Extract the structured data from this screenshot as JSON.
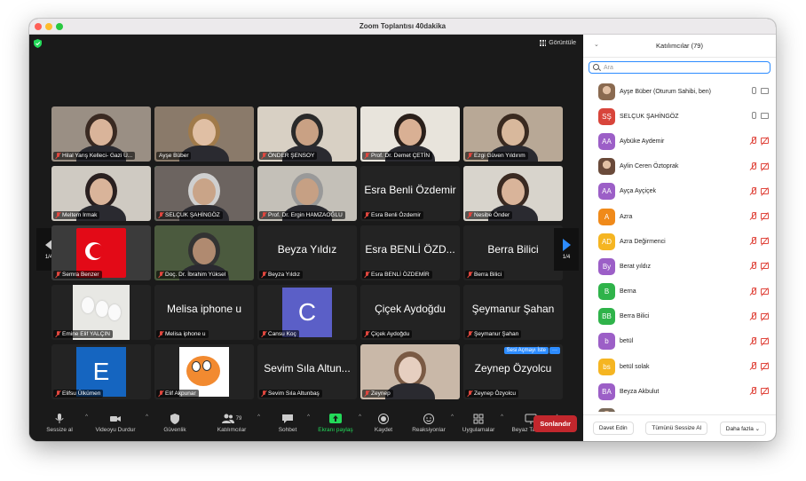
{
  "window": {
    "title": "Zoom Toplantısı  40dakika"
  },
  "view_button": {
    "label": "Görüntüle"
  },
  "pagination": {
    "left": "1/4",
    "right": "1/4"
  },
  "tiles": [
    {
      "label": "Hilal Yarış Kelleci- Gazi Ü...",
      "kind": "video",
      "bg": "#9a8f84",
      "face": "#d9b49a",
      "hair": "#3a2a22"
    },
    {
      "label": "Ayşe Büber",
      "kind": "video",
      "bg": "#8a7a6a",
      "face": "#e0bfa4",
      "hair": "#a07a4a"
    },
    {
      "label": "ÖNDER ŞENSOY",
      "kind": "video",
      "bg": "#d8d0c4",
      "face": "#c9a184",
      "hair": "#2a2a2a"
    },
    {
      "label": "Prof. Dr. Demet ÇETİN",
      "kind": "video",
      "bg": "#e8e4dc",
      "face": "#d9b094",
      "hair": "#2a1f1a"
    },
    {
      "label": "Ezgi Güven Yıldırım",
      "kind": "video",
      "bg": "#b8a896",
      "face": "#d8b89c",
      "hair": "#3a2a20"
    },
    {
      "label": "Meltem Irmak",
      "kind": "video",
      "bg": "#cfcac2",
      "face": "#d9b49a",
      "hair": "#2a2020"
    },
    {
      "label": "SELÇUK ŞAHİNGÖZ",
      "kind": "video",
      "bg": "#6c6460",
      "face": "#c9a488",
      "hair": "#cfcfcf",
      "active": true
    },
    {
      "label": "Prof. Dr. Ergin HAMZAOĞLU",
      "kind": "video",
      "bg": "#c4c0b8",
      "face": "#c6a084",
      "hair": "#999"
    },
    {
      "label": "Esra Benli Özdemir",
      "kind": "name",
      "big": "Esra Benli Özdemir"
    },
    {
      "label": "Nesibe Önder",
      "kind": "video",
      "bg": "#d8d4cc",
      "face": "#d9b49a",
      "hair": "#3a2a22"
    },
    {
      "label": "Semra Benzer",
      "kind": "flag",
      "bg": "#3b3b3b"
    },
    {
      "label": "Doç. Dr. İbrahim Yüksel",
      "kind": "video",
      "bg": "#4b5a3e",
      "face": "#b08a70",
      "hair": "#333"
    },
    {
      "label": "Beyza Yıldız",
      "kind": "name",
      "big": "Beyza Yıldız"
    },
    {
      "label": "Esra BENLİ ÖZDEMİR",
      "kind": "name",
      "big": "Esra BENLİ ÖZD..."
    },
    {
      "label": "Berra Bilici",
      "kind": "name",
      "big": "Berra Bilici"
    },
    {
      "label": "Emine Elif YALÇIN",
      "kind": "flowers",
      "bg": "#e8e8e4"
    },
    {
      "label": "Melisa iphone u",
      "kind": "name",
      "big": "Melisa iphone u"
    },
    {
      "label": "Cansu Koç",
      "kind": "letter",
      "letter": "C",
      "color": "#5b5fc7"
    },
    {
      "label": "Çiçek Aydoğdu",
      "kind": "name",
      "big": "Çiçek Aydoğdu"
    },
    {
      "label": "Şeymanur Şahan",
      "kind": "name",
      "big": "Şeymanur Şahan"
    },
    {
      "label": "Elifsu Ülkümen",
      "kind": "letter",
      "letter": "E",
      "color": "#1565c0"
    },
    {
      "label": "Elif Akpunar",
      "kind": "cartoon",
      "bg": "#ffffff"
    },
    {
      "label": "Sevim Sıla Altunbaş",
      "kind": "name",
      "big": "Sevim Sıla Altun..."
    },
    {
      "label": "Zeynep",
      "kind": "video",
      "bg": "#c9b8a8",
      "face": "#e6cfc0",
      "hair": "#7a5a44"
    },
    {
      "label": "Zeynep Özyolcu",
      "kind": "name",
      "big": "Zeynep Özyolcu",
      "request": "Sesi Açmayı İste"
    }
  ],
  "toolbar": {
    "mute": "Sessize al",
    "video": "Videoyu Durdur",
    "security": "Güvenlik",
    "participants": "Katılımcılar",
    "participants_count": "79",
    "chat": "Sohbet",
    "share": "Ekranı paylaş",
    "record": "Kaydet",
    "reactions": "Reaksiyonlar",
    "apps": "Uygulamalar",
    "whiteboard": "Beyaz Tahtalar",
    "end": "Sonlandır"
  },
  "panel": {
    "title": "Katılımcılar (79)",
    "search_placeholder": "Ara",
    "participants": [
      {
        "name": "Ayşe Büber (Oturum Sahibi, ben)",
        "initials": "",
        "color": "#8a6a50",
        "photo": true,
        "muted": false
      },
      {
        "name": "SELÇUK ŞAHİNGÖZ",
        "initials": "SŞ",
        "color": "#d8453b",
        "muted": false
      },
      {
        "name": "Aybüke Aydemir",
        "initials": "AA",
        "color": "#9c5fc7",
        "muted": true
      },
      {
        "name": "Aylin Ceren Öztoprak",
        "initials": "",
        "color": "#6a4a3a",
        "photo": true,
        "muted": true
      },
      {
        "name": "Ayça Ayçiçek",
        "initials": "AA",
        "color": "#9c5fc7",
        "muted": true
      },
      {
        "name": "Azra",
        "initials": "A",
        "color": "#f08a1a",
        "muted": true
      },
      {
        "name": "Azra Değirmenci",
        "initials": "AD",
        "color": "#f5b522",
        "muted": true
      },
      {
        "name": "Berat yıldız",
        "initials": "By",
        "color": "#9c5fc7",
        "muted": true
      },
      {
        "name": "Berna",
        "initials": "B",
        "color": "#2fb34a",
        "muted": true
      },
      {
        "name": "Berra Bilici",
        "initials": "BB",
        "color": "#2fb34a",
        "muted": true
      },
      {
        "name": "betül",
        "initials": "b",
        "color": "#9c5fc7",
        "muted": true
      },
      {
        "name": "betül solak",
        "initials": "bs",
        "color": "#f5b522",
        "muted": true
      },
      {
        "name": "Beyza Akbulut",
        "initials": "BA",
        "color": "#9c5fc7",
        "muted": true
      },
      {
        "name": "",
        "initials": "",
        "color": "#7a6a5a",
        "photo": true,
        "muted": true
      }
    ],
    "invite": "Davet Edin",
    "mute_all": "Tümünü Sessize Al",
    "more": "Daha fazla"
  }
}
